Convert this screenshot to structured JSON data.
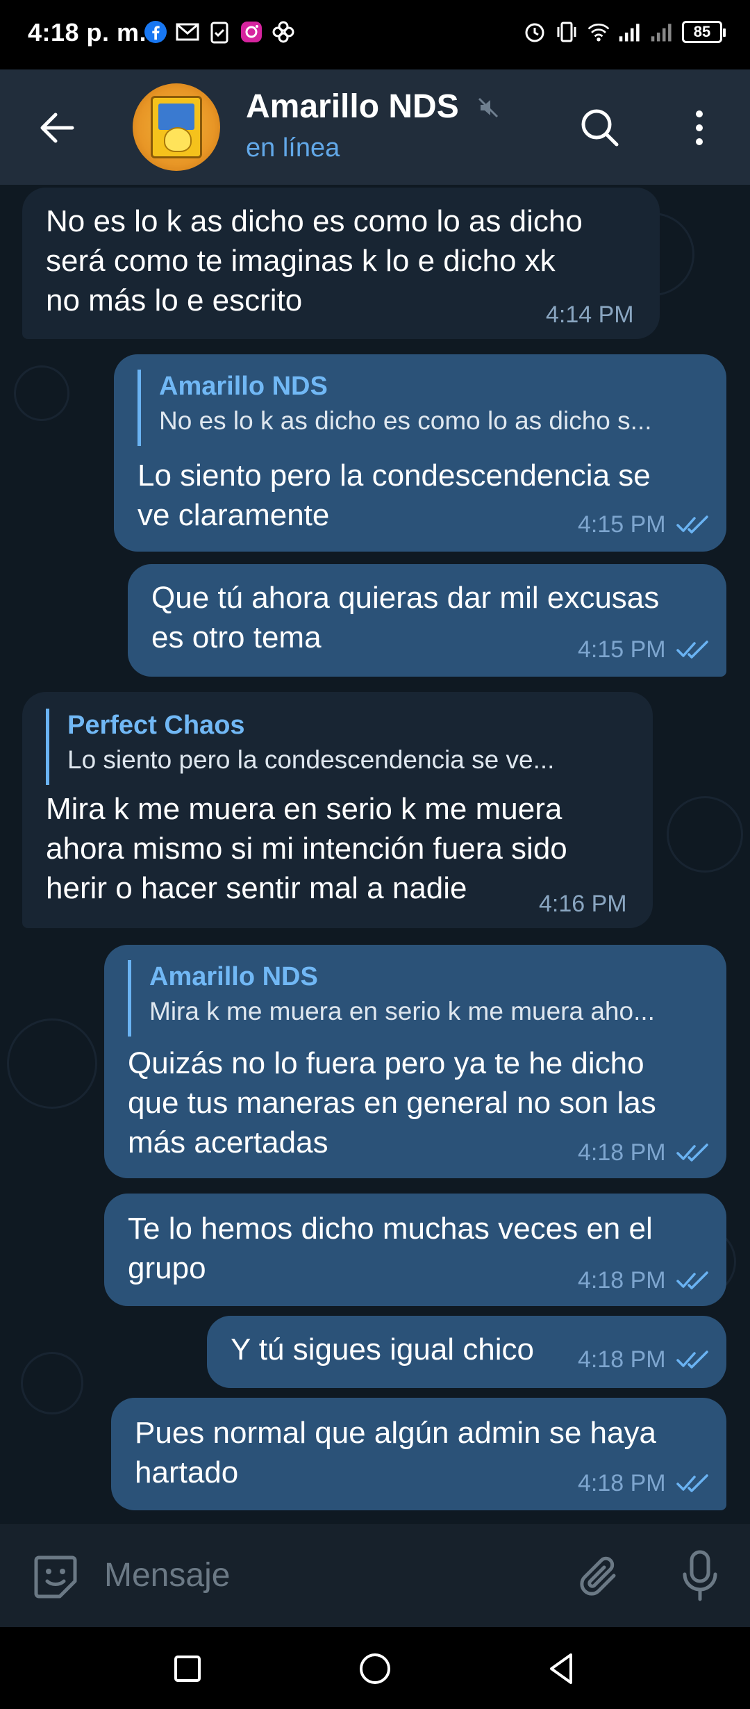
{
  "status_bar": {
    "time": "4:18 p. m.",
    "battery": "85",
    "left_icons": [
      "facebook-icon",
      "gmail-icon",
      "clipboard-icon",
      "instagram-icon",
      "pinwheel-icon"
    ],
    "right_icons": [
      "alarm-icon",
      "vibrate-icon",
      "wifi-icon",
      "signal-icon",
      "signal-icon",
      "battery-icon"
    ]
  },
  "header": {
    "title": "Amarillo NDS",
    "status": "en línea",
    "muted": true
  },
  "messages": [
    {
      "direction": "in",
      "text": "No es lo k as dicho es como lo as dicho\nserá como te imaginas k lo e dicho xk\nno más lo e escrito",
      "time": "4:14 PM"
    },
    {
      "direction": "out",
      "reply_name": "Amarillo NDS",
      "reply_text": "No es lo k as dicho es como lo as dicho s...",
      "text": "Lo siento pero la condescendencia se\nve claramente",
      "time": "4:15 PM"
    },
    {
      "direction": "out",
      "text": "Que tú ahora quieras dar mil excusas\nes otro tema",
      "time": "4:15 PM"
    },
    {
      "direction": "in",
      "reply_name": "Perfect Chaos",
      "reply_text": "Lo siento pero la condescendencia se ve...",
      "text": "Mira k me muera en serio k me muera\nahora mismo si mi intención fuera sido\nherir o hacer sentir mal a nadie",
      "time": "4:16 PM"
    },
    {
      "direction": "out",
      "reply_name": "Amarillo NDS",
      "reply_text": "Mira k me muera en serio k me muera aho...",
      "text": "Quizás no lo fuera pero ya te he dicho\nque tus maneras en general no son las\nmás acertadas",
      "time": "4:18 PM"
    },
    {
      "direction": "out",
      "text": "Te lo hemos dicho muchas veces en el\ngrupo",
      "time": "4:18 PM"
    },
    {
      "direction": "out",
      "text": "Y tú sigues igual chico",
      "time": "4:18 PM"
    },
    {
      "direction": "out",
      "text": "Pues normal que algún admin se haya\nhartado",
      "time": "4:18 PM"
    }
  ],
  "input": {
    "placeholder": "Mensaje"
  },
  "colors": {
    "header_bg": "#212d3b",
    "chat_bg": "#0f1922",
    "bubble_in": "#182533",
    "bubble_out": "#2b5278",
    "accent": "#62a8e8"
  }
}
